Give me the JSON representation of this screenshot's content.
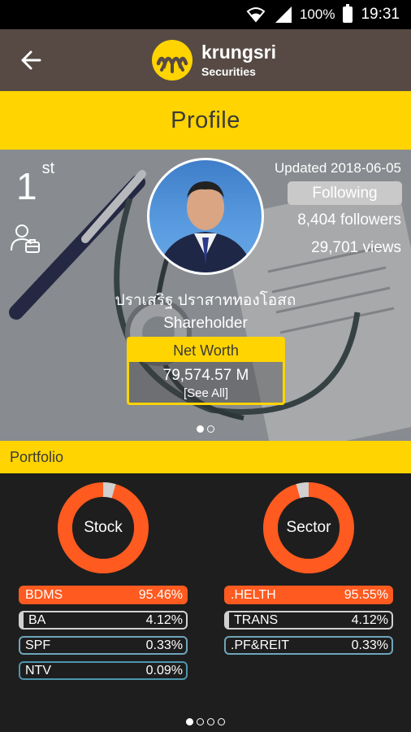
{
  "status_bar": {
    "battery": "100%",
    "time": "19:31"
  },
  "header": {
    "brand": "krungsri",
    "sub": "Securities"
  },
  "title": "Profile",
  "profile": {
    "rank": "1",
    "rank_suffix": "st",
    "updated": "Updated 2018-06-05",
    "follow_label": "Following",
    "followers": "8,404 followers",
    "views": "29,701 views",
    "name": "ปราเสริฐ ปราสาททองโอสถ",
    "role": "Shareholder",
    "networth_label": "Net Worth",
    "networth_value": "79,574.57 M",
    "see_all": "[See All]"
  },
  "portfolio": {
    "label": "Portfolio",
    "stock": {
      "title": "Stock",
      "items": [
        {
          "name": "BDMS",
          "value": "95.46%"
        },
        {
          "name": "BA",
          "value": "4.12%"
        },
        {
          "name": "SPF",
          "value": "0.33%"
        },
        {
          "name": "NTV",
          "value": "0.09%"
        }
      ]
    },
    "sector": {
      "title": "Sector",
      "items": [
        {
          "name": ".HELTH",
          "value": "95.55%"
        },
        {
          "name": "TRANS",
          "value": "4.12%"
        },
        {
          "name": ".PF&REIT",
          "value": "0.33%"
        }
      ]
    }
  },
  "colors": {
    "brand_yellow": "#ffd400",
    "header_brown": "#574a44",
    "accent_orange": "#ff5a1f"
  }
}
